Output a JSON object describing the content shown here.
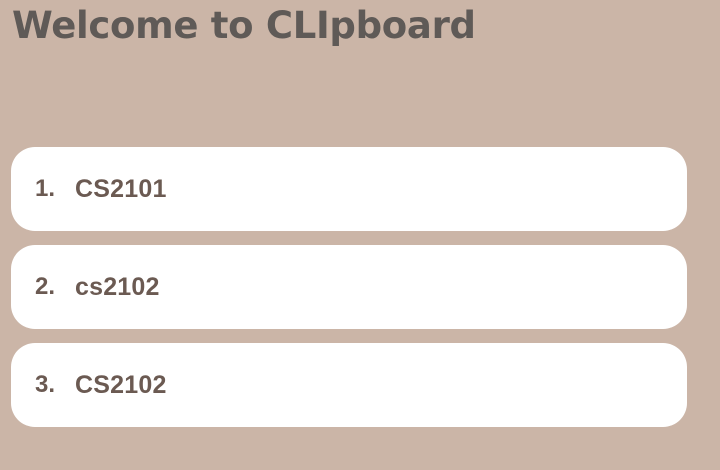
{
  "header": {
    "title": "Welcome to CLIpboard"
  },
  "courses": [
    {
      "number": "1.",
      "name": "CS2101"
    },
    {
      "number": "2.",
      "name": "cs2102"
    },
    {
      "number": "3.",
      "name": "CS2102"
    }
  ]
}
